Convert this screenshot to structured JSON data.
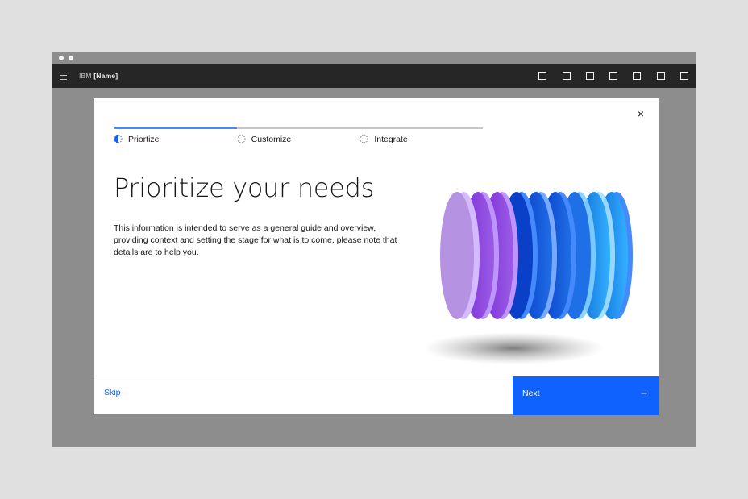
{
  "shell": {
    "brand_prefix": "IBM",
    "brand_name": "[Name]",
    "action_icons": [
      "square-icon",
      "square-icon",
      "square-icon",
      "square-icon",
      "square-icon",
      "square-icon",
      "square-icon"
    ]
  },
  "modal": {
    "close_symbol": "×",
    "steps": [
      {
        "label": "Priortize",
        "state": "current"
      },
      {
        "label": "Customize",
        "state": "incomplete"
      },
      {
        "label": "Integrate",
        "state": "incomplete"
      }
    ],
    "title": "Prioritize your needs",
    "body": "This information is intended to serve as a general guide and overview, providing context and setting the stage for what is to come, please note that details are to help you.",
    "skip_label": "Skip",
    "next_label": "Next",
    "next_arrow": "→"
  },
  "colors": {
    "accent": "#0f62fe",
    "progress_active": "#4589ff",
    "shell": "#262626",
    "overlay": "#8d8d8d"
  }
}
